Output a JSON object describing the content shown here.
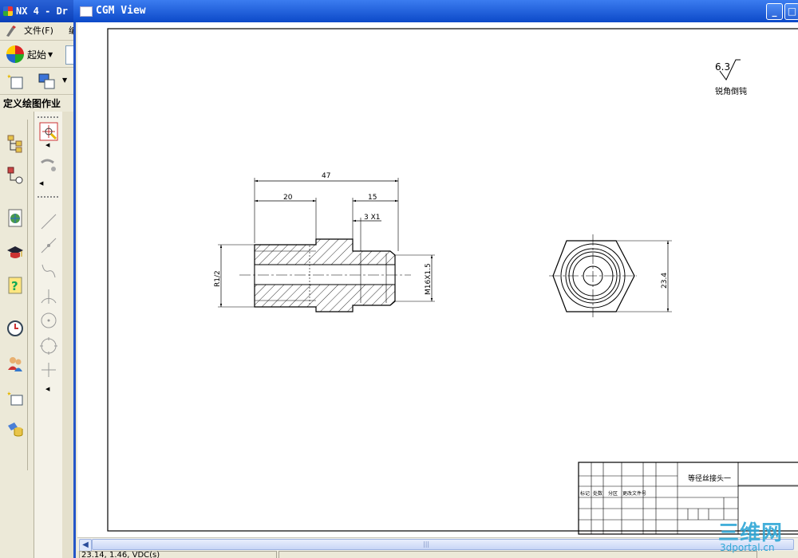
{
  "nx_window": {
    "title": "NX 4 - Dr",
    "menu": {
      "file_label": "文件(F)",
      "next_label": "编"
    },
    "toolbar": {
      "start_label": "起始"
    },
    "palette_title": "定义绘图作业"
  },
  "cgm_window": {
    "title": "CGM View",
    "buttons": {
      "minimize": "_",
      "maximize": "□"
    }
  },
  "drawing": {
    "dims": {
      "overall_length": "47",
      "left_length": "20",
      "right_length": "15",
      "groove": "3 X1",
      "pipe_thread": "R1/2",
      "thread": "M16X1.5",
      "across_flats": "23.4"
    },
    "finish_value": "6.3",
    "note": "锐角倒钝",
    "title_block": {
      "part_name": "等径丝接头一",
      "labels": [
        "标记",
        "处数",
        "分区",
        "更改文件号"
      ]
    }
  },
  "statusbar": {
    "text": "23.14, 1.46, VDC(s)"
  },
  "watermark": {
    "brand": "三维网",
    "url": "3dportal.cn"
  }
}
